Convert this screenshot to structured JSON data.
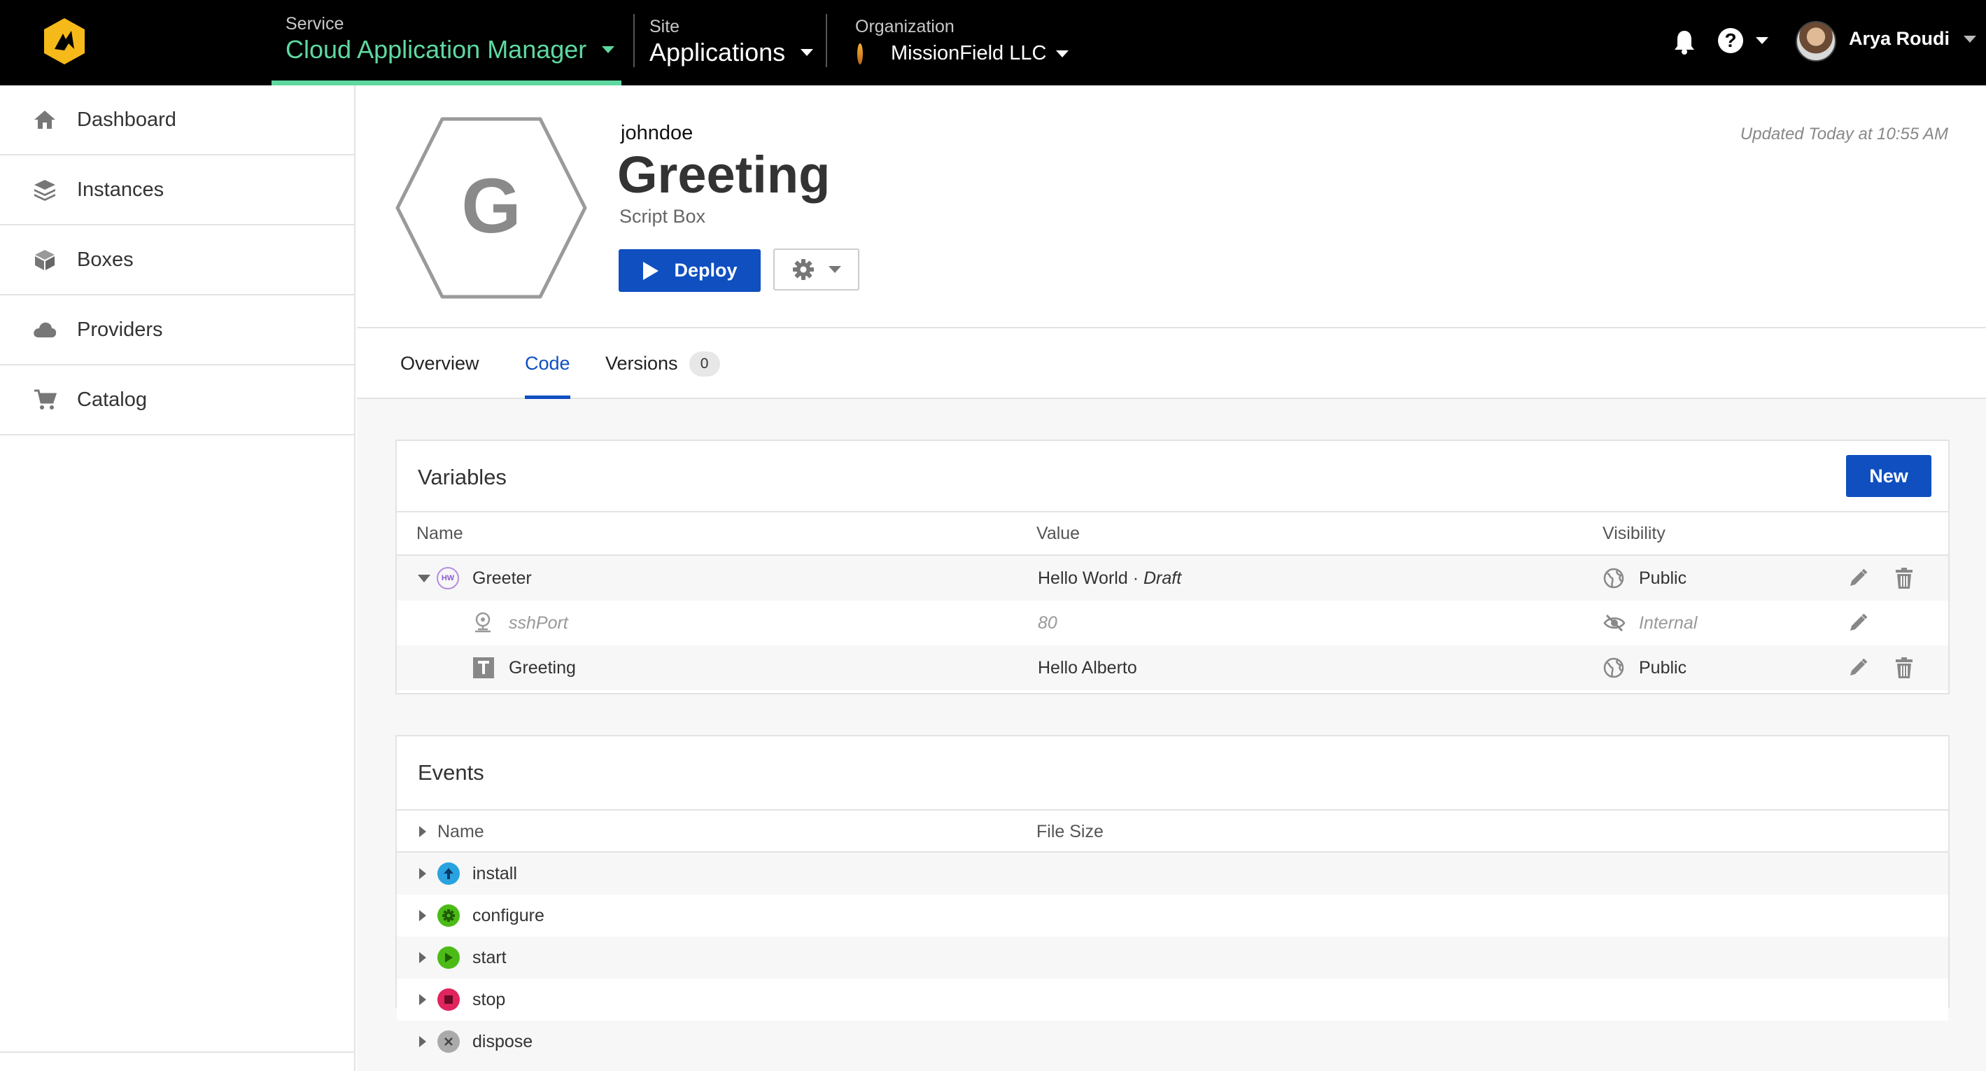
{
  "topbar": {
    "service": {
      "caption": "Service",
      "value": "Cloud Application Manager"
    },
    "site": {
      "caption": "Site",
      "value": "Applications"
    },
    "organization": {
      "caption": "Organization",
      "value": "MissionField LLC"
    },
    "user_name": "Arya Roudi",
    "help_glyph": "?",
    "accent_color": "#5fd8a0"
  },
  "sidebar": {
    "items": [
      {
        "label": "Dashboard",
        "icon": "home-icon"
      },
      {
        "label": "Instances",
        "icon": "layers-icon"
      },
      {
        "label": "Boxes",
        "icon": "cube-icon"
      },
      {
        "label": "Providers",
        "icon": "cloud-icon"
      },
      {
        "label": "Catalog",
        "icon": "cart-icon"
      }
    ]
  },
  "box": {
    "logo_letter": "G",
    "owner": "johndoe",
    "title": "Greeting",
    "subtitle": "Script Box",
    "deploy_label": "Deploy",
    "updated": "Updated Today at 10:55 AM"
  },
  "tabs": {
    "overview": "Overview",
    "code": "Code",
    "versions": "Versions",
    "versions_count": "0",
    "active": "Code"
  },
  "variables": {
    "title": "Variables",
    "new_label": "New",
    "columns": {
      "name": "Name",
      "value": "Value",
      "visibility": "Visibility"
    },
    "rows": [
      {
        "name": "Greeter",
        "value": "Hello World · ",
        "value_suffix": "Draft",
        "visibility": "Public",
        "icon": "box-reference-icon",
        "icon_text": "HW"
      },
      {
        "name": "sshPort",
        "value": "80",
        "visibility": "Internal",
        "icon": "port-icon"
      },
      {
        "name": "Greeting",
        "value": "Hello Alberto",
        "visibility": "Public",
        "icon": "text-type-icon"
      }
    ]
  },
  "events": {
    "title": "Events",
    "columns": {
      "name": "Name",
      "file_size": "File Size"
    },
    "rows": [
      {
        "name": "install",
        "icon": "install-icon",
        "color": "#29a3e0"
      },
      {
        "name": "configure",
        "icon": "configure-icon",
        "color": "#4cbb17"
      },
      {
        "name": "start",
        "icon": "start-icon",
        "color": "#4cbb17"
      },
      {
        "name": "stop",
        "icon": "stop-icon",
        "color": "#e0245e"
      },
      {
        "name": "dispose",
        "icon": "dispose-icon",
        "color": "#aaaaaa"
      }
    ]
  },
  "colors": {
    "primary": "#0f4fc0",
    "accent": "#5fd8a0"
  }
}
